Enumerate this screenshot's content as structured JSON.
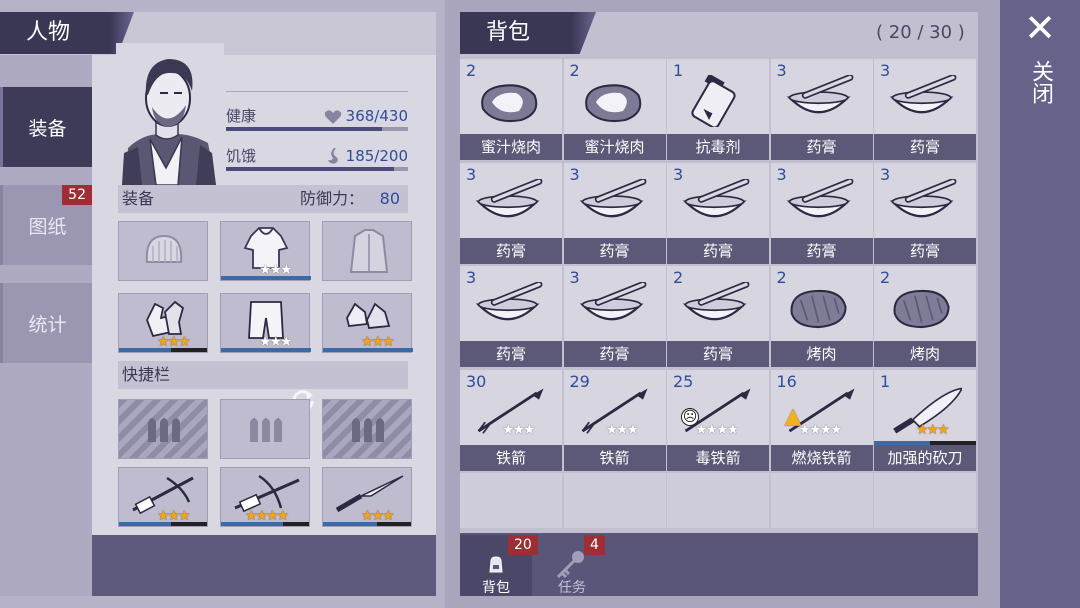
{
  "character": {
    "title": "人物",
    "tabs": [
      {
        "label": "装备",
        "active": true
      },
      {
        "label": "图纸",
        "badge": "52"
      },
      {
        "label": "统计"
      }
    ],
    "stats": {
      "health_label": "健康",
      "health_value": "368/430",
      "health_fraction": 0.856,
      "hunger_label": "饥饿",
      "hunger_value": "185/200",
      "hunger_fraction": 0.925
    },
    "equipment": {
      "label": "装备",
      "defense_label": "防御力：",
      "defense_value": "80",
      "slots": [
        {
          "icon": "beanie-hat-icon",
          "stars": 0
        },
        {
          "icon": "hooded-shirt-icon",
          "stars": 3,
          "star_color": "white"
        },
        {
          "icon": "jacket-icon",
          "stars": 0
        },
        {
          "icon": "gloves-icon",
          "stars": 3,
          "star_color": "gold"
        },
        {
          "icon": "shorts-icon",
          "stars": 3,
          "star_color": "white"
        },
        {
          "icon": "sneakers-icon",
          "stars": 3,
          "star_color": "gold"
        }
      ]
    },
    "quickbar": {
      "label": "快捷栏",
      "slots": [
        {
          "icon": "ammo-icon",
          "locked": true
        },
        {
          "icon": "ammo-icon",
          "locked": false
        },
        {
          "icon": "ammo-icon",
          "locked": true
        },
        {
          "icon": "crossbow-icon",
          "stars": 3
        },
        {
          "icon": "crossbow-icon",
          "stars": 4
        },
        {
          "icon": "knife-icon",
          "stars": 3
        }
      ]
    }
  },
  "bag": {
    "title": "背包",
    "capacity": "( 20 / 30 )",
    "items": [
      {
        "count": "2",
        "name": "蜜汁烧肉",
        "icon": "honey-meat-icon"
      },
      {
        "count": "2",
        "name": "蜜汁烧肉",
        "icon": "honey-meat-icon"
      },
      {
        "count": "1",
        "name": "抗毒剂",
        "icon": "antidote-vial-icon"
      },
      {
        "count": "3",
        "name": "药膏",
        "icon": "mortar-pestle-icon"
      },
      {
        "count": "3",
        "name": "药膏",
        "icon": "mortar-pestle-icon"
      },
      {
        "count": "3",
        "name": "药膏",
        "icon": "mortar-pestle-icon"
      },
      {
        "count": "3",
        "name": "药膏",
        "icon": "mortar-pestle-icon"
      },
      {
        "count": "3",
        "name": "药膏",
        "icon": "mortar-pestle-icon"
      },
      {
        "count": "3",
        "name": "药膏",
        "icon": "mortar-pestle-icon"
      },
      {
        "count": "3",
        "name": "药膏",
        "icon": "mortar-pestle-icon"
      },
      {
        "count": "3",
        "name": "药膏",
        "icon": "mortar-pestle-icon"
      },
      {
        "count": "3",
        "name": "药膏",
        "icon": "mortar-pestle-icon"
      },
      {
        "count": "2",
        "name": "药膏",
        "icon": "mortar-pestle-icon"
      },
      {
        "count": "2",
        "name": "烤肉",
        "icon": "roast-meat-icon"
      },
      {
        "count": "2",
        "name": "烤肉",
        "icon": "roast-meat-icon"
      },
      {
        "count": "30",
        "name": "铁箭",
        "icon": "iron-arrow-icon",
        "stars": 3
      },
      {
        "count": "29",
        "name": "铁箭",
        "icon": "iron-arrow-icon",
        "stars": 3
      },
      {
        "count": "25",
        "name": "毒铁箭",
        "icon": "poison-arrow-icon",
        "stars": 4
      },
      {
        "count": "16",
        "name": "燃烧铁箭",
        "icon": "fire-arrow-icon",
        "stars": 4
      },
      {
        "count": "1",
        "name": "加强的砍刀",
        "icon": "machete-icon",
        "stars": 3,
        "star_color": "gold"
      }
    ],
    "tabs": [
      {
        "label": "背包",
        "badge": "20",
        "icon": "backpack-icon",
        "active": true
      },
      {
        "label": "任务",
        "badge": "4",
        "icon": "key-icon"
      }
    ]
  },
  "close": {
    "label": "关闭",
    "icon": "close-icon"
  },
  "colors": {
    "panel_dark": "#3a3755",
    "value_blue": "#2f4d9a",
    "badge_red": "#9d2f34",
    "star_gold": "#f3a41d"
  }
}
